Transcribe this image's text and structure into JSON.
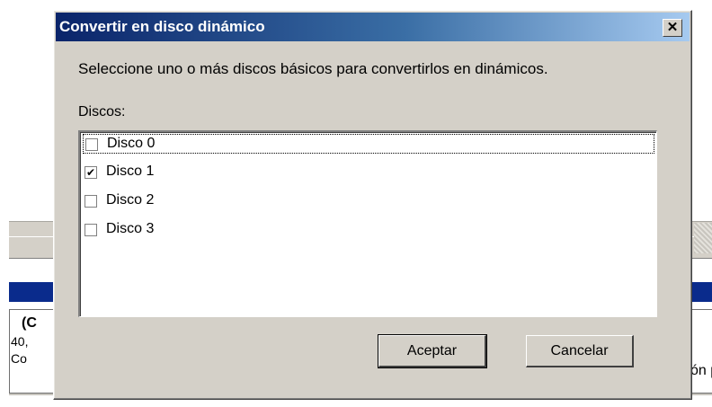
{
  "background": {
    "panel_title_fragment": "(C",
    "size_fragment": "40,",
    "status_fragment": "Co",
    "right_fragment": "ón p"
  },
  "dialog": {
    "title": "Convertir en disco dinámico",
    "close_glyph": "✕",
    "instruction": "Seleccione uno o más discos básicos para convertirlos en dinámicos.",
    "disks_label": "Discos:",
    "disks": [
      {
        "label": "Disco 0",
        "checked": false,
        "focused": true
      },
      {
        "label": "Disco 1",
        "checked": true,
        "focused": false
      },
      {
        "label": "Disco 2",
        "checked": false,
        "focused": false
      },
      {
        "label": "Disco 3",
        "checked": false,
        "focused": false
      }
    ],
    "ok_label": "Aceptar",
    "cancel_label": "Cancelar"
  },
  "colors": {
    "title_gradient_start": "#0a246a",
    "title_gradient_end": "#a6caf0",
    "dialog_face": "#d4d0c8",
    "background_header": "#0a2b8c"
  }
}
